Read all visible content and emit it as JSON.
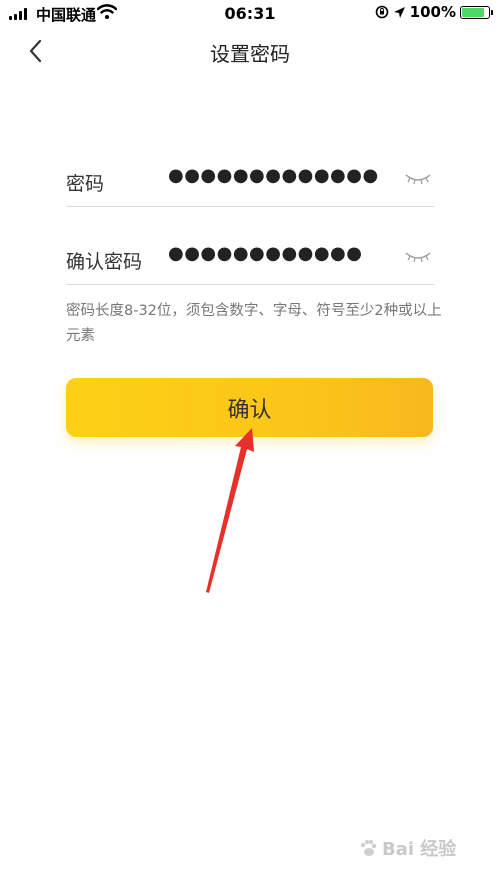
{
  "status_bar": {
    "carrier": "中国联通",
    "time": "06:31",
    "battery_percent": "100%",
    "battery_level": 1.0
  },
  "nav": {
    "title": "设置密码",
    "back_icon": "chevron-left-icon"
  },
  "form": {
    "password": {
      "label": "密码",
      "value": "●●●●●●●●●●●●●",
      "toggle_icon": "eye-closed-icon"
    },
    "confirm_password": {
      "label": "确认密码",
      "value": "●●●●●●●●●●●●",
      "toggle_icon": "eye-closed-icon"
    },
    "hint": "密码长度8-32位，须包含数字、字母、符号至少2种或以上元素"
  },
  "confirm_button": {
    "label": "确认"
  },
  "annotation": {
    "color": "#e8302a"
  },
  "watermark": {
    "text": "Bai 经验"
  },
  "colors": {
    "accent": "#fcc717",
    "battery": "#4cd964"
  }
}
